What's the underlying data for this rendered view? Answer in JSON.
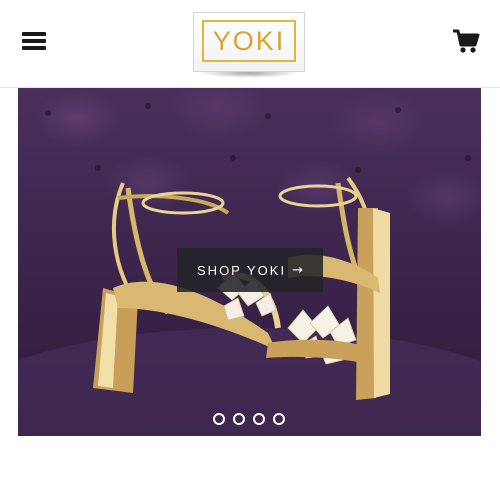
{
  "header": {
    "logo_text": "YOKI",
    "menu_icon": "hamburger-menu-icon",
    "cart_icon": "shopping-cart-icon"
  },
  "hero": {
    "cta_label": "SHOP YOKI",
    "cta_arrow": "→",
    "slides_total": 4,
    "active_slide": 1
  },
  "colors": {
    "brand_gold": "#e7b43a",
    "hero_purple": "#3f2750",
    "cta_bg": "#232328"
  }
}
